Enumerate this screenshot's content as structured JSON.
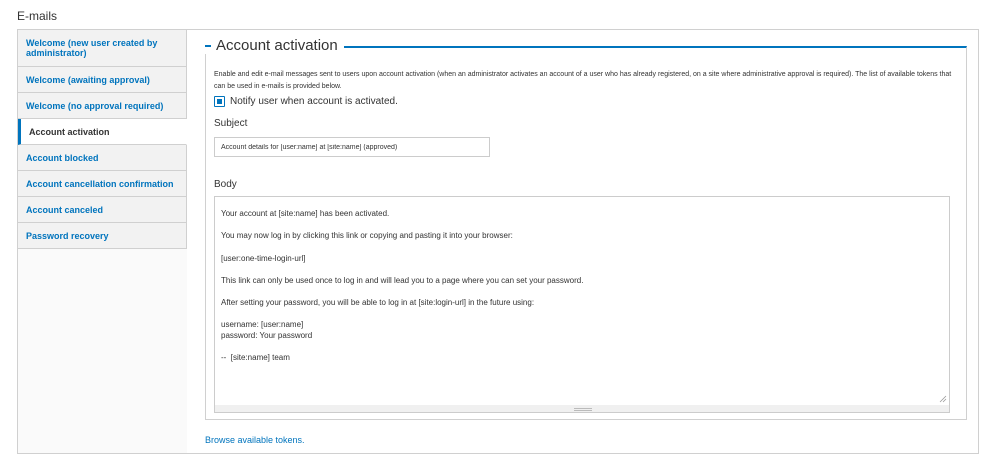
{
  "page": {
    "heading": "E-mails"
  },
  "tabs": [
    {
      "label": "Welcome (new user created by administrator)",
      "active": false
    },
    {
      "label": "Welcome (awaiting approval)",
      "active": false
    },
    {
      "label": "Welcome (no approval required)",
      "active": false
    },
    {
      "label": "Account activation",
      "active": true
    },
    {
      "label": "Account blocked",
      "active": false
    },
    {
      "label": "Account cancellation confirmation",
      "active": false
    },
    {
      "label": "Account canceled",
      "active": false
    },
    {
      "label": "Password recovery",
      "active": false
    }
  ],
  "section": {
    "title": "Account activation",
    "description": "Enable and edit e-mail messages sent to users upon account activation (when an administrator activates an account of a user who has already registered, on a site where administrative approval is required). The list of available tokens that can be used in e-mails is provided below.",
    "notify_checkbox": {
      "label": "Notify user when account is activated.",
      "checked": true
    },
    "subject": {
      "label": "Subject",
      "value": "Account details for [user:name] at [site:name] (approved)"
    },
    "body": {
      "label": "Body",
      "value": "[user:name],\n\nYour account at [site:name] has been activated.\n\nYou may now log in by clicking this link or copying and pasting it into your browser:\n\n[user:one-time-login-url]\n\nThis link can only be used once to log in and will lead you to a page where you can set your password.\n\nAfter setting your password, you will be able to log in at [site:login-url] in the future using:\n\nusername: [user:name]\npassword: Your password\n\n--  [site:name] team"
    }
  },
  "footer": {
    "browse_tokens_link": "Browse available tokens."
  },
  "colors": {
    "accent": "#0074bd",
    "border": "#d0d0d0",
    "text": "#333333"
  }
}
